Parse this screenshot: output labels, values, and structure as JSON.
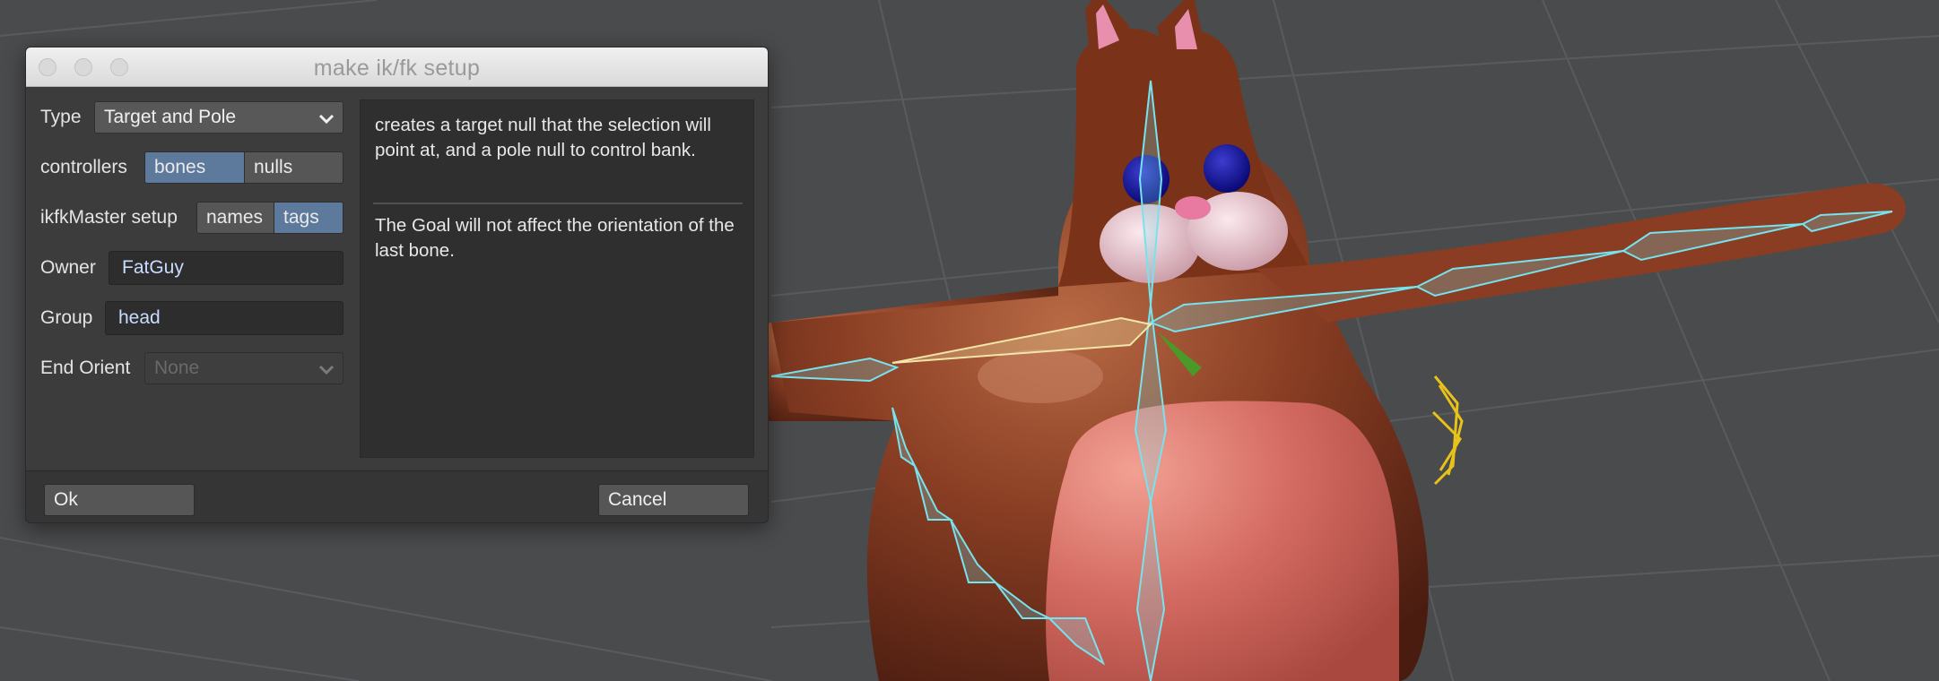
{
  "dialog": {
    "title": "make ik/fk setup",
    "type": {
      "label": "Type",
      "value": "Target and Pole"
    },
    "controllers": {
      "label": "controllers",
      "options": [
        "bones",
        "nulls"
      ],
      "selected": "bones"
    },
    "ikfk_master": {
      "label": "ikfkMaster setup",
      "options": [
        "names",
        "tags"
      ],
      "selected": "tags"
    },
    "owner": {
      "label": "Owner",
      "value": "FatGuy"
    },
    "group": {
      "label": "Group",
      "value": "head"
    },
    "end_orient": {
      "label": "End Orient",
      "value": "None",
      "disabled": true
    },
    "description": {
      "text1": "creates a target null that the selection will point at, and a pole null to control bank.",
      "text2": "The Goal will not affect the orientation of the last bone."
    },
    "buttons": {
      "ok": "Ok",
      "cancel": "Cancel"
    }
  },
  "colors": {
    "segment_selected": "#5d7a9c",
    "field_text": "#c9dcff",
    "viewport_bg": "#4a4b4d",
    "character_body": "#8a3d22",
    "belly": "#d46b62",
    "bones_unselected": "#76e3ee",
    "bones_selected": "#f3e6a8"
  }
}
